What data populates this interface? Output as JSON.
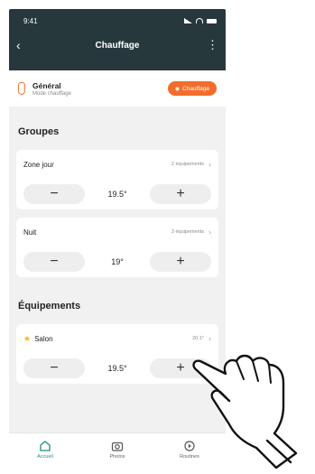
{
  "status": {
    "time": "9:41"
  },
  "nav": {
    "title": "Chauffage"
  },
  "general": {
    "title": "Général",
    "subtitle": "Mode chauffage",
    "mode_button": "Chauffage"
  },
  "groups": {
    "title": "Groupes",
    "items": [
      {
        "name": "Zone jour",
        "meta": "2 équipements",
        "temp": "19.5°"
      },
      {
        "name": "Nuit",
        "meta": "3 équipements",
        "temp": "19°"
      }
    ]
  },
  "equipments": {
    "title": "Équipements",
    "items": [
      {
        "name": "Salon",
        "meta": "20.1°",
        "temp": "19.5°"
      }
    ]
  },
  "tabs": [
    {
      "label": "Accueil",
      "icon": "home-icon"
    },
    {
      "label": "Photos",
      "icon": "camera-icon"
    },
    {
      "label": "Routines",
      "icon": "routines-icon"
    }
  ],
  "colors": {
    "header": "#27383d",
    "accent": "#f26d2c",
    "active_tab": "#1d8f88",
    "star": "#f2b632"
  }
}
